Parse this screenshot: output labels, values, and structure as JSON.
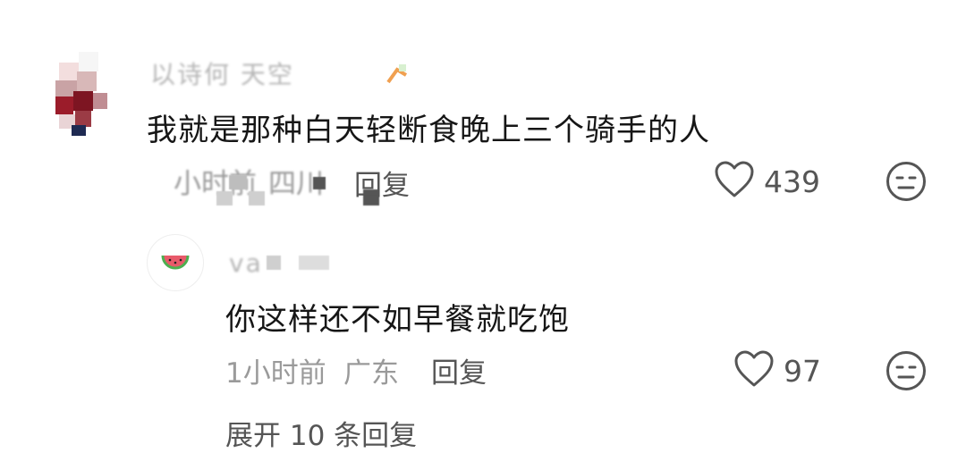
{
  "comments": [
    {
      "username": "以诗何 天空",
      "text": "我就是那种白天轻断食晚上三个骑手的人",
      "time": "小时前",
      "location": "四川",
      "reply_label": "回复",
      "likes": "439"
    }
  ],
  "replies": [
    {
      "username": "va",
      "text": "你这样还不如早餐就吃饱",
      "time": "1小时前",
      "location": "广东",
      "reply_label": "回复",
      "likes": "97"
    }
  ],
  "expand_label": "展开 10 条回复",
  "icons": {
    "like": "heart-outline-icon",
    "react": "neutral-face-icon"
  },
  "colors": {
    "text": "#161616",
    "meta": "#9a9a9a",
    "action": "#555555",
    "icon": "#555555"
  }
}
